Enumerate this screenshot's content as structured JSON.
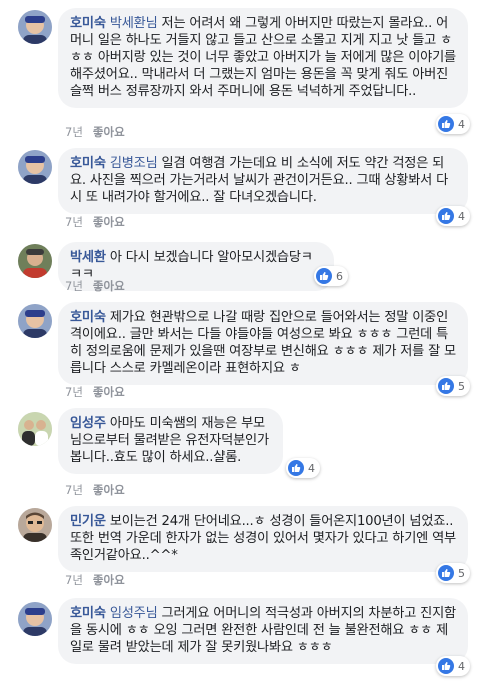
{
  "comments": [
    {
      "author": "호미숙",
      "tag": "박세환님",
      "text": "저는 어려서 왜 그렇게 아버지만 따랐는지 몰라요.. 어머니 일은 하나도 거들지 않고 들고 산으로 소몰고 지게 지고 낫 들고 ㅎㅎㅎ 아버지랑 있는 것이 너무 좋았고 아버지가 늘 저에게 많은 이야기를 해주셨어요.. 막내라서 더 그랬는지 엄마는 용돈을 꼭 맞게 줘도 아버진 슬쩍 버스 정류장까지 와서 주머니에 용돈 넉넉하게 주었답니다..",
      "time": "7년",
      "like_label": "좋아요",
      "reactions": "4",
      "avatar_icon": "profile-photo"
    },
    {
      "author": "호미숙",
      "tag": "김병조님",
      "text": "일겸 여행겸 가는데요 비 소식에 저도 약간 걱정은 되요. 사진을 찍으러 가는거라서 날씨가 관건이거든요.. 그때 상황봐서 다시 또 내려가야 할거에요.. 잘 다녀오겠습니다.",
      "time": "7년",
      "like_label": "좋아요",
      "reactions": "4",
      "avatar_icon": "profile-photo"
    },
    {
      "author": "박세환",
      "tag": "",
      "text": "아 다시 보겠습니다 알아모시겠습당ㅋㅋㅋ",
      "time": "7년",
      "like_label": "좋아요",
      "reactions": "6",
      "avatar_icon": "profile-photo"
    },
    {
      "author": "호미숙",
      "tag": "",
      "text": "제가요 현관밖으로 나갈 때랑 집안으로 들어와서는 정말 이중인격이에요.. 글만 봐서는 다들 야들야들 여성으로 봐요 ㅎㅎㅎ 그런데 특히 정의로움에 문제가 있을땐 여장부로 변신해요 ㅎㅎㅎ 제가 저를 잘 모릅니다 스스로 카멜레온이라 표현하지요 ㅎ",
      "time": "7년",
      "like_label": "좋아요",
      "reactions": "5",
      "avatar_icon": "profile-photo"
    },
    {
      "author": "임성주",
      "tag": "",
      "text": "아마도 미숙쌤의 재능은 부모님으로부터 물려받은 유전자덕분인가 봅니다..효도 많이 하세요..샬롬.",
      "time": "7년",
      "like_label": "좋아요",
      "reactions": "4",
      "avatar_icon": "profile-photo"
    },
    {
      "author": "민기운",
      "tag": "",
      "text": "보이는건 24개 단어네요...ㅎ 성경이 들어온지100년이 넘었죠..또한 번역 가운데 한자가 없는 성경이 있어서 몇자가 있다고 하기엔 역부족인거같아요..^^*",
      "time": "7년",
      "like_label": "좋아요",
      "reactions": "5",
      "avatar_icon": "profile-photo"
    },
    {
      "author": "호미숙",
      "tag": "임성주님",
      "text": "그러게요 어머니의 적극성과 아버지의 차분하고 진지함을 동시에 ㅎㅎ 오잉 그러면 완전한 사람인데 전 늘 불완전해요 ㅎㅎ 제일로 물려 받았는데 제가 잘 못키웠나봐요 ㅎㅎㅎ",
      "time": "",
      "like_label": "",
      "reactions": "4",
      "avatar_icon": "profile-photo"
    }
  ]
}
